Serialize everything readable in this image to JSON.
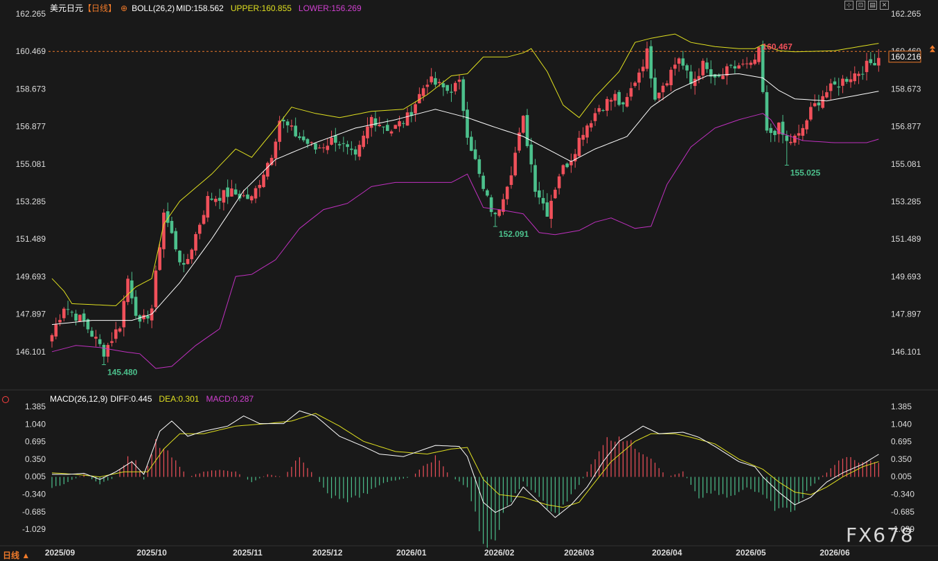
{
  "header": {
    "symbol": "美元日元",
    "period_tag": "【日线】",
    "boll_label": "BOLL(26,2)",
    "mid_label": "MID:158.562",
    "upper_label": "UPPER:160.855",
    "lower_label": "LOWER:156.269"
  },
  "macd_header": {
    "name": "MACD(26,12,9)",
    "diff": "DIFF:0.445",
    "dea": "DEA:0.301",
    "macd": "MACD:0.287"
  },
  "toolbar": {
    "icons": [
      "fit-icon",
      "restore-icon",
      "doc-icon",
      "close-icon"
    ],
    "glyphs": [
      "⊹",
      "⊡",
      "▤",
      "✕"
    ]
  },
  "period_label": "日线 ▲",
  "watermark": "FX678",
  "colors": {
    "up": "#f0505a",
    "down": "#4cc08c",
    "mid": "#ffffff",
    "upper": "#e0e020",
    "lower": "#c030c0",
    "diff": "#ffffff",
    "dea": "#e0e020",
    "last_price_bg": "#f07a2a",
    "axis_text": "#dcdcdc"
  },
  "chart_data": [
    {
      "type": "candlestick",
      "title": "美元日元",
      "y_ticks": [
        "162.265",
        "160.469",
        "158.673",
        "156.877",
        "155.081",
        "153.285",
        "151.489",
        "149.693",
        "147.897",
        "146.101"
      ],
      "ylim": [
        145.2,
        162.265
      ],
      "x_labels": [
        "2025/09",
        "2025/10",
        "2025/11",
        "2025/12",
        "2026/01",
        "2026/02",
        "2026/03",
        "2026/04",
        "2026/05",
        "2026/06"
      ],
      "x_label_index": [
        2,
        25,
        49,
        69,
        90,
        112,
        132,
        154,
        175,
        196
      ],
      "last_price": "160.216",
      "ref_line_price": 160.467,
      "annotations": [
        {
          "text": "145.480",
          "index": 13,
          "value": 145.48,
          "kind": "low"
        },
        {
          "text": "152.091",
          "index": 111,
          "value": 152.091,
          "kind": "low"
        },
        {
          "text": "160.467",
          "index": 177,
          "value": 160.467,
          "kind": "high"
        },
        {
          "text": "155.025",
          "index": 184,
          "value": 155.025,
          "kind": "low"
        }
      ],
      "anchors": [
        [
          0,
          146.9
        ],
        [
          3,
          148.3
        ],
        [
          8,
          147.5
        ],
        [
          13,
          146.1
        ],
        [
          17,
          147.4
        ],
        [
          19,
          149.6
        ],
        [
          22,
          147.3
        ],
        [
          25,
          148.2
        ],
        [
          28,
          152.8
        ],
        [
          33,
          150.0
        ],
        [
          39,
          153.4
        ],
        [
          45,
          153.7
        ],
        [
          50,
          153.4
        ],
        [
          55,
          155.6
        ],
        [
          57,
          157.2
        ],
        [
          61,
          156.5
        ],
        [
          66,
          155.8
        ],
        [
          71,
          156.3
        ],
        [
          76,
          155.3
        ],
        [
          80,
          157.3
        ],
        [
          85,
          156.7
        ],
        [
          89,
          157.3
        ],
        [
          94,
          159.1
        ],
        [
          99,
          158.6
        ],
        [
          102,
          158.9
        ],
        [
          104,
          156.6
        ],
        [
          108,
          153.8
        ],
        [
          111,
          152.5
        ],
        [
          115,
          154.8
        ],
        [
          118,
          157.2
        ],
        [
          121,
          154.0
        ],
        [
          124,
          152.8
        ],
        [
          127,
          154.6
        ],
        [
          130,
          155.4
        ],
        [
          133,
          156.7
        ],
        [
          137,
          157.8
        ],
        [
          141,
          158.3
        ],
        [
          143,
          157.7
        ],
        [
          146,
          159.1
        ],
        [
          149,
          160.4
        ],
        [
          151,
          158.4
        ],
        [
          154,
          159.2
        ],
        [
          157,
          160.2
        ],
        [
          160,
          158.9
        ],
        [
          163,
          159.8
        ],
        [
          166,
          159.0
        ],
        [
          169,
          159.5
        ],
        [
          172,
          159.8
        ],
        [
          175,
          159.7
        ],
        [
          177,
          160.4
        ],
        [
          179,
          156.5
        ],
        [
          182,
          156.8
        ],
        [
          184,
          156.1
        ],
        [
          187,
          156.4
        ],
        [
          190,
          157.6
        ],
        [
          193,
          158.4
        ],
        [
          196,
          158.8
        ],
        [
          199,
          159.2
        ],
        [
          202,
          159.5
        ],
        [
          205,
          159.9
        ],
        [
          207,
          160.216
        ]
      ],
      "boll_mid": [
        [
          0,
          147.4
        ],
        [
          10,
          147.6
        ],
        [
          20,
          147.6
        ],
        [
          25,
          147.9
        ],
        [
          32,
          149.4
        ],
        [
          40,
          151.5
        ],
        [
          48,
          153.8
        ],
        [
          56,
          155.3
        ],
        [
          66,
          156.1
        ],
        [
          76,
          156.8
        ],
        [
          86,
          157.2
        ],
        [
          96,
          157.7
        ],
        [
          104,
          157.3
        ],
        [
          110,
          156.9
        ],
        [
          118,
          156.4
        ],
        [
          124,
          155.8
        ],
        [
          130,
          155.2
        ],
        [
          136,
          155.8
        ],
        [
          144,
          156.4
        ],
        [
          150,
          157.8
        ],
        [
          156,
          158.6
        ],
        [
          164,
          159.3
        ],
        [
          172,
          159.4
        ],
        [
          178,
          159.2
        ],
        [
          182,
          158.6
        ],
        [
          186,
          158.2
        ],
        [
          194,
          158.1
        ],
        [
          207,
          158.562
        ]
      ],
      "boll_upper": [
        [
          0,
          149.6
        ],
        [
          3,
          149.0
        ],
        [
          5,
          148.4
        ],
        [
          16,
          148.3
        ],
        [
          21,
          149.2
        ],
        [
          25,
          149.6
        ],
        [
          28,
          152.2
        ],
        [
          32,
          153.3
        ],
        [
          40,
          154.6
        ],
        [
          46,
          155.8
        ],
        [
          50,
          155.4
        ],
        [
          56,
          156.8
        ],
        [
          60,
          157.8
        ],
        [
          66,
          157.5
        ],
        [
          72,
          157.3
        ],
        [
          80,
          157.6
        ],
        [
          88,
          157.7
        ],
        [
          94,
          158.4
        ],
        [
          100,
          159.3
        ],
        [
          104,
          159.4
        ],
        [
          108,
          160.2
        ],
        [
          114,
          160.2
        ],
        [
          118,
          160.4
        ],
        [
          120,
          160.6
        ],
        [
          124,
          159.5
        ],
        [
          128,
          157.9
        ],
        [
          132,
          157.3
        ],
        [
          136,
          158.3
        ],
        [
          142,
          159.5
        ],
        [
          146,
          160.9
        ],
        [
          150,
          161.1
        ],
        [
          156,
          161.3
        ],
        [
          160,
          160.9
        ],
        [
          166,
          160.7
        ],
        [
          172,
          160.6
        ],
        [
          176,
          160.6
        ],
        [
          178,
          160.8
        ],
        [
          182,
          160.5
        ],
        [
          186,
          160.45
        ],
        [
          196,
          160.5
        ],
        [
          207,
          160.855
        ]
      ],
      "boll_lower": [
        [
          0,
          146.1
        ],
        [
          2,
          146.2
        ],
        [
          6,
          146.4
        ],
        [
          12,
          146.3
        ],
        [
          18,
          146.1
        ],
        [
          22,
          146.0
        ],
        [
          26,
          145.3
        ],
        [
          30,
          145.4
        ],
        [
          36,
          146.4
        ],
        [
          42,
          147.2
        ],
        [
          46,
          149.7
        ],
        [
          50,
          149.8
        ],
        [
          56,
          150.5
        ],
        [
          62,
          152.0
        ],
        [
          68,
          152.9
        ],
        [
          74,
          153.2
        ],
        [
          80,
          154.0
        ],
        [
          86,
          154.2
        ],
        [
          92,
          154.2
        ],
        [
          100,
          154.2
        ],
        [
          104,
          154.6
        ],
        [
          108,
          153.0
        ],
        [
          112,
          152.9
        ],
        [
          118,
          152.7
        ],
        [
          122,
          151.8
        ],
        [
          126,
          151.7
        ],
        [
          132,
          151.9
        ],
        [
          136,
          152.3
        ],
        [
          140,
          152.5
        ],
        [
          146,
          152.0
        ],
        [
          150,
          152.1
        ],
        [
          154,
          154.1
        ],
        [
          160,
          155.9
        ],
        [
          166,
          156.8
        ],
        [
          172,
          157.2
        ],
        [
          178,
          157.5
        ],
        [
          180,
          157.2
        ],
        [
          182,
          156.6
        ],
        [
          188,
          156.2
        ],
        [
          196,
          156.1
        ],
        [
          204,
          156.1
        ],
        [
          207,
          156.269
        ]
      ]
    },
    {
      "type": "macd",
      "title": "MACD(26,12,9)",
      "y_ticks": [
        "1.385",
        "1.040",
        "0.695",
        "0.350",
        "0.005",
        "-0.340",
        "-0.685",
        "-1.029"
      ],
      "ylim": [
        -1.25,
        1.55
      ],
      "diff": [
        [
          0,
          0.05
        ],
        [
          4,
          0.05
        ],
        [
          8,
          0.07
        ],
        [
          12,
          -0.05
        ],
        [
          16,
          0.1
        ],
        [
          20,
          0.3
        ],
        [
          23,
          0.05
        ],
        [
          27,
          0.9
        ],
        [
          30,
          1.1
        ],
        [
          34,
          0.8
        ],
        [
          38,
          0.9
        ],
        [
          44,
          1.0
        ],
        [
          48,
          1.2
        ],
        [
          52,
          1.05
        ],
        [
          58,
          1.05
        ],
        [
          62,
          1.3
        ],
        [
          66,
          1.2
        ],
        [
          72,
          0.8
        ],
        [
          78,
          0.6
        ],
        [
          82,
          0.45
        ],
        [
          88,
          0.4
        ],
        [
          96,
          0.62
        ],
        [
          102,
          0.6
        ],
        [
          104,
          0.4
        ],
        [
          108,
          -0.5
        ],
        [
          111,
          -0.7
        ],
        [
          115,
          -0.55
        ],
        [
          118,
          -0.2
        ],
        [
          122,
          -0.5
        ],
        [
          126,
          -0.8
        ],
        [
          130,
          -0.55
        ],
        [
          134,
          -0.2
        ],
        [
          138,
          0.3
        ],
        [
          142,
          0.7
        ],
        [
          148,
          1.0
        ],
        [
          152,
          0.85
        ],
        [
          158,
          0.88
        ],
        [
          162,
          0.78
        ],
        [
          166,
          0.6
        ],
        [
          172,
          0.3
        ],
        [
          176,
          0.2
        ],
        [
          178,
          0.0
        ],
        [
          182,
          -0.3
        ],
        [
          186,
          -0.55
        ],
        [
          190,
          -0.4
        ],
        [
          194,
          -0.1
        ],
        [
          198,
          0.08
        ],
        [
          203,
          0.25
        ],
        [
          207,
          0.445
        ]
      ],
      "dea": [
        [
          0,
          0.08
        ],
        [
          6,
          0.05
        ],
        [
          12,
          0.0
        ],
        [
          18,
          0.1
        ],
        [
          24,
          0.1
        ],
        [
          28,
          0.55
        ],
        [
          32,
          0.85
        ],
        [
          38,
          0.85
        ],
        [
          46,
          1.0
        ],
        [
          54,
          1.05
        ],
        [
          60,
          1.1
        ],
        [
          66,
          1.25
        ],
        [
          72,
          1.0
        ],
        [
          78,
          0.7
        ],
        [
          86,
          0.5
        ],
        [
          94,
          0.45
        ],
        [
          100,
          0.55
        ],
        [
          104,
          0.58
        ],
        [
          108,
          -0.05
        ],
        [
          112,
          -0.35
        ],
        [
          118,
          -0.4
        ],
        [
          124,
          -0.55
        ],
        [
          128,
          -0.6
        ],
        [
          132,
          -0.5
        ],
        [
          136,
          -0.1
        ],
        [
          140,
          0.3
        ],
        [
          146,
          0.7
        ],
        [
          150,
          0.85
        ],
        [
          156,
          0.85
        ],
        [
          160,
          0.78
        ],
        [
          166,
          0.65
        ],
        [
          172,
          0.35
        ],
        [
          178,
          0.15
        ],
        [
          182,
          -0.1
        ],
        [
          186,
          -0.3
        ],
        [
          190,
          -0.35
        ],
        [
          194,
          -0.2
        ],
        [
          198,
          0.0
        ],
        [
          203,
          0.2
        ],
        [
          207,
          0.301
        ]
      ],
      "macd_hist": [
        [
          0,
          -0.25
        ],
        [
          4,
          -0.1
        ],
        [
          8,
          0.05
        ],
        [
          12,
          -0.15
        ],
        [
          16,
          0.0
        ],
        [
          19,
          0.4
        ],
        [
          21,
          0.3
        ],
        [
          23,
          -0.05
        ],
        [
          26,
          0.7
        ],
        [
          30,
          0.4
        ],
        [
          34,
          0.0
        ],
        [
          40,
          0.15
        ],
        [
          46,
          0.1
        ],
        [
          50,
          -0.1
        ],
        [
          54,
          0.05
        ],
        [
          58,
          0.0
        ],
        [
          62,
          0.4
        ],
        [
          66,
          0.0
        ],
        [
          70,
          -0.4
        ],
        [
          74,
          -0.5
        ],
        [
          78,
          -0.35
        ],
        [
          84,
          -0.1
        ],
        [
          90,
          0.0
        ],
        [
          96,
          0.4
        ],
        [
          100,
          0.0
        ],
        [
          104,
          -0.2
        ],
        [
          108,
          -1.3
        ],
        [
          110,
          -1.4
        ],
        [
          114,
          -0.6
        ],
        [
          118,
          -0.1
        ],
        [
          122,
          -0.4
        ],
        [
          126,
          -0.8
        ],
        [
          130,
          -0.4
        ],
        [
          134,
          0.1
        ],
        [
          138,
          0.7
        ],
        [
          142,
          0.85
        ],
        [
          146,
          0.6
        ],
        [
          150,
          0.4
        ],
        [
          154,
          0.0
        ],
        [
          158,
          0.1
        ],
        [
          162,
          -0.4
        ],
        [
          166,
          -0.3
        ],
        [
          170,
          -0.4
        ],
        [
          174,
          -0.2
        ],
        [
          178,
          -0.4
        ],
        [
          182,
          -0.7
        ],
        [
          186,
          -0.65
        ],
        [
          190,
          -0.2
        ],
        [
          194,
          0.1
        ],
        [
          198,
          0.4
        ],
        [
          203,
          0.3
        ],
        [
          207,
          0.287
        ]
      ]
    }
  ]
}
